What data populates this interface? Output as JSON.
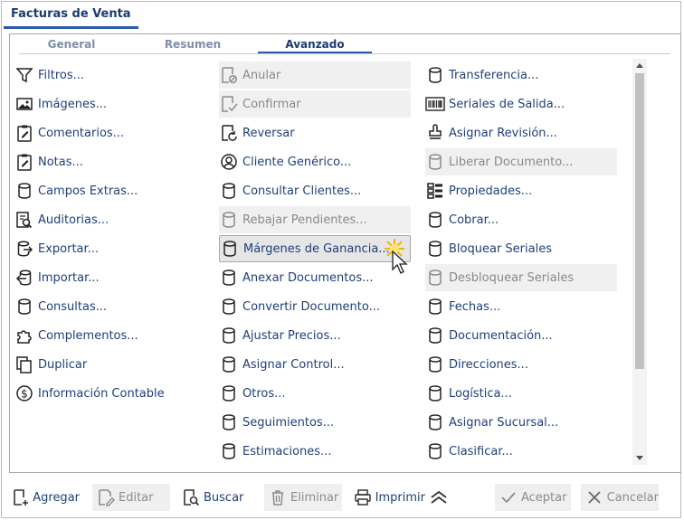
{
  "window": {
    "title": "Facturas de Venta"
  },
  "tabs": [
    {
      "label": "General",
      "active": false
    },
    {
      "label": "Resumen",
      "active": false
    },
    {
      "label": "Avanzado",
      "active": true
    }
  ],
  "columns": [
    [
      {
        "label": "Filtros...",
        "icon": "filter-icon",
        "state": "normal"
      },
      {
        "label": "Imágenes...",
        "icon": "image-icon",
        "state": "normal"
      },
      {
        "label": "Comentarios...",
        "icon": "clipboard-edit-icon",
        "state": "normal"
      },
      {
        "label": "Notas...",
        "icon": "clipboard-edit-icon",
        "state": "normal"
      },
      {
        "label": "Campos Extras...",
        "icon": "database-icon",
        "state": "normal"
      },
      {
        "label": "Auditorias...",
        "icon": "audit-search-icon",
        "state": "normal"
      },
      {
        "label": "Exportar...",
        "icon": "export-icon",
        "state": "normal"
      },
      {
        "label": "Importar...",
        "icon": "import-icon",
        "state": "normal"
      },
      {
        "label": "Consultas...",
        "icon": "database-icon",
        "state": "normal"
      },
      {
        "label": "Complementos...",
        "icon": "puzzle-icon",
        "state": "normal"
      },
      {
        "label": "Duplicar",
        "icon": "copy-icon",
        "state": "normal"
      },
      {
        "label": "Información Contable",
        "icon": "dollar-circle-icon",
        "state": "normal"
      }
    ],
    [
      {
        "label": "Anular",
        "icon": "document-cancel-icon",
        "state": "disabled"
      },
      {
        "label": "Confirmar",
        "icon": "document-check-icon",
        "state": "disabled"
      },
      {
        "label": "Reversar",
        "icon": "document-undo-icon",
        "state": "normal"
      },
      {
        "label": "Cliente Genérico...",
        "icon": "user-circle-icon",
        "state": "normal"
      },
      {
        "label": "Consultar Clientes...",
        "icon": "database-icon",
        "state": "normal"
      },
      {
        "label": "Rebajar Pendientes...",
        "icon": "database-icon",
        "state": "disabled"
      },
      {
        "label": "Márgenes de Ganancia...",
        "icon": "database-icon",
        "state": "selected"
      },
      {
        "label": "Anexar Documentos...",
        "icon": "database-icon",
        "state": "normal"
      },
      {
        "label": "Convertir Documento...",
        "icon": "database-icon",
        "state": "normal"
      },
      {
        "label": "Ajustar Precios...",
        "icon": "database-icon",
        "state": "normal"
      },
      {
        "label": "Asignar Control...",
        "icon": "database-icon",
        "state": "normal"
      },
      {
        "label": "Otros...",
        "icon": "database-icon",
        "state": "normal"
      },
      {
        "label": "Seguimientos...",
        "icon": "database-icon",
        "state": "normal"
      },
      {
        "label": "Estimaciones...",
        "icon": "database-icon",
        "state": "normal"
      }
    ],
    [
      {
        "label": "Transferencia...",
        "icon": "database-icon",
        "state": "normal"
      },
      {
        "label": "Seriales de Salida...",
        "icon": "barcode-icon",
        "state": "normal"
      },
      {
        "label": "Asignar Revisión...",
        "icon": "stamp-icon",
        "state": "normal"
      },
      {
        "label": "Liberar Documento...",
        "icon": "database-icon",
        "state": "disabled"
      },
      {
        "label": "Propiedades...",
        "icon": "properties-grid-icon",
        "state": "normal"
      },
      {
        "label": "Cobrar...",
        "icon": "database-icon",
        "state": "normal"
      },
      {
        "label": "Bloquear Seriales",
        "icon": "database-icon",
        "state": "normal"
      },
      {
        "label": "Desbloquear Seriales",
        "icon": "database-icon",
        "state": "disabled"
      },
      {
        "label": "Fechas...",
        "icon": "database-icon",
        "state": "normal"
      },
      {
        "label": "Documentación...",
        "icon": "database-icon",
        "state": "normal"
      },
      {
        "label": "Direcciones...",
        "icon": "database-icon",
        "state": "normal"
      },
      {
        "label": "Logística...",
        "icon": "database-icon",
        "state": "normal"
      },
      {
        "label": "Asignar Sucursal...",
        "icon": "database-icon",
        "state": "normal"
      },
      {
        "label": "Clasificar...",
        "icon": "database-icon",
        "state": "normal"
      }
    ]
  ],
  "footer": {
    "agregar": "Agregar",
    "editar": "Editar",
    "buscar": "Buscar",
    "eliminar": "Eliminar",
    "imprimir": "Imprimir",
    "aceptar": "Aceptar",
    "cancelar": "Cancelar"
  },
  "colors": {
    "accent": "#2b5aa6",
    "text": "#1f3f78",
    "disabled_text": "#8a8a8a",
    "disabled_bg": "#f0f0f0"
  }
}
